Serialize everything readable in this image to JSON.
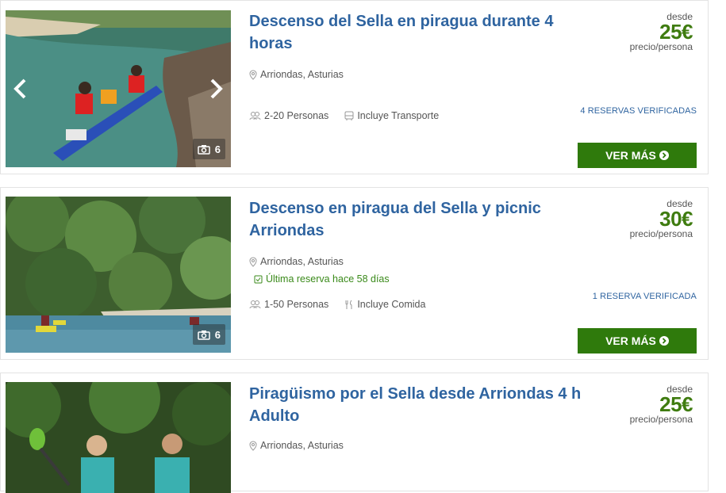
{
  "listings": [
    {
      "title": "Descenso del Sella en piragua durante 4 horas",
      "location": "Arriondas, Asturias",
      "persons": "2-20 Personas",
      "extra": "Incluye Transporte",
      "extra_icon": "bus-icon",
      "desde": "desde",
      "price": "25€",
      "per": "precio/persona",
      "verified": "4 RESERVAS VERIFICADAS",
      "button": "VER MÁS",
      "photo_count": "6"
    },
    {
      "title": "Descenso en piragua del Sella y picnic Arriondas",
      "location": "Arriondas, Asturias",
      "last_booking": "Última reserva hace 58 días",
      "persons": "1-50 Personas",
      "extra": "Incluye Comida",
      "extra_icon": "cutlery-icon",
      "desde": "desde",
      "price": "30€",
      "per": "precio/persona",
      "verified": "1 RESERVA VERIFICADA",
      "button": "VER MÁS",
      "photo_count": "6"
    },
    {
      "title": "Piragüismo por el Sella desde Arriondas 4 h Adulto",
      "location": "Arriondas, Asturias",
      "desde": "desde",
      "price": "25€",
      "per": "precio/persona"
    }
  ],
  "colors": {
    "title": "#2f64a0",
    "price": "#3f7c10",
    "button": "#2f7a0c",
    "last_booking": "#3a8a1a"
  }
}
